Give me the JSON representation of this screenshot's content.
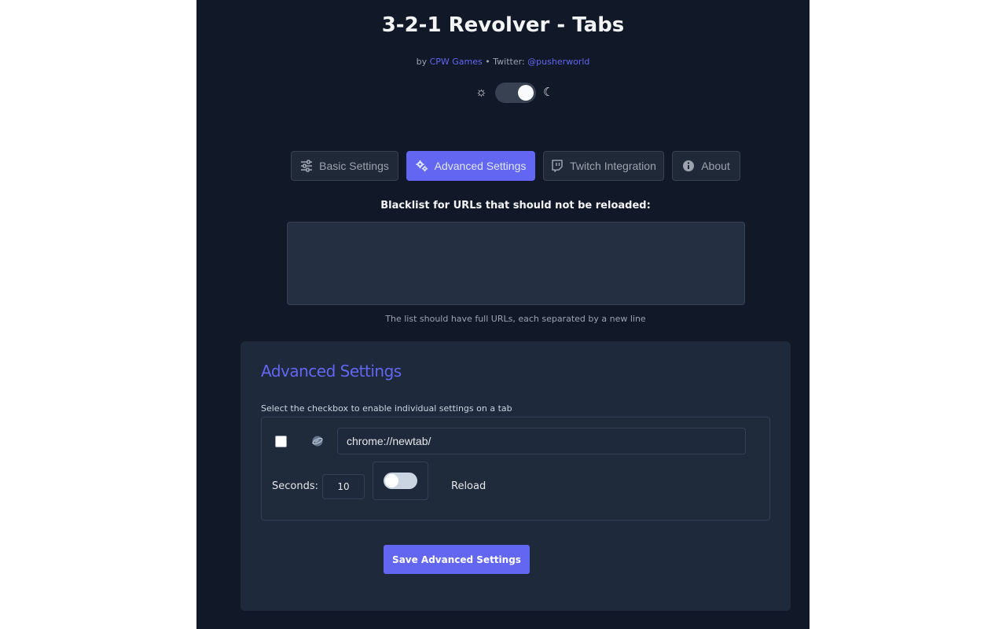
{
  "header": {
    "title": "3-2-1 Revolver - Tabs",
    "by_prefix": "by",
    "author": "CPW Games",
    "separator": "•",
    "twitter_prefix": "Twitter:",
    "twitter_handle": "@pusherworld"
  },
  "theme": {
    "light_icon": "sun-icon",
    "dark_icon": "moon-icon",
    "mode": "dark"
  },
  "tabs": [
    {
      "label": "Basic Settings",
      "icon": "sliders-icon",
      "active": false
    },
    {
      "label": "Advanced Settings",
      "icon": "gears-icon",
      "active": true
    },
    {
      "label": "Twitch Integration",
      "icon": "twitch-icon",
      "active": false
    },
    {
      "label": "About",
      "icon": "info-icon",
      "active": false
    }
  ],
  "blacklist": {
    "label": "Blacklist for URLs that should not be reloaded:",
    "value": "",
    "hint": "The list should have full URLs, each separated by a new line"
  },
  "advanced": {
    "title": "Advanced Settings",
    "hint": "Select the checkbox to enable individual settings on a tab",
    "tab_row": {
      "checked": false,
      "favicon": "globe-icon",
      "url": "chrome://newtab/",
      "seconds_label": "Seconds:",
      "seconds": "10",
      "reload_enabled": false,
      "reload_label": "Reload"
    },
    "save_label": "Save Advanced Settings"
  },
  "colors": {
    "accent": "#6366f1",
    "background": "#111827",
    "card": "#1e293b"
  }
}
